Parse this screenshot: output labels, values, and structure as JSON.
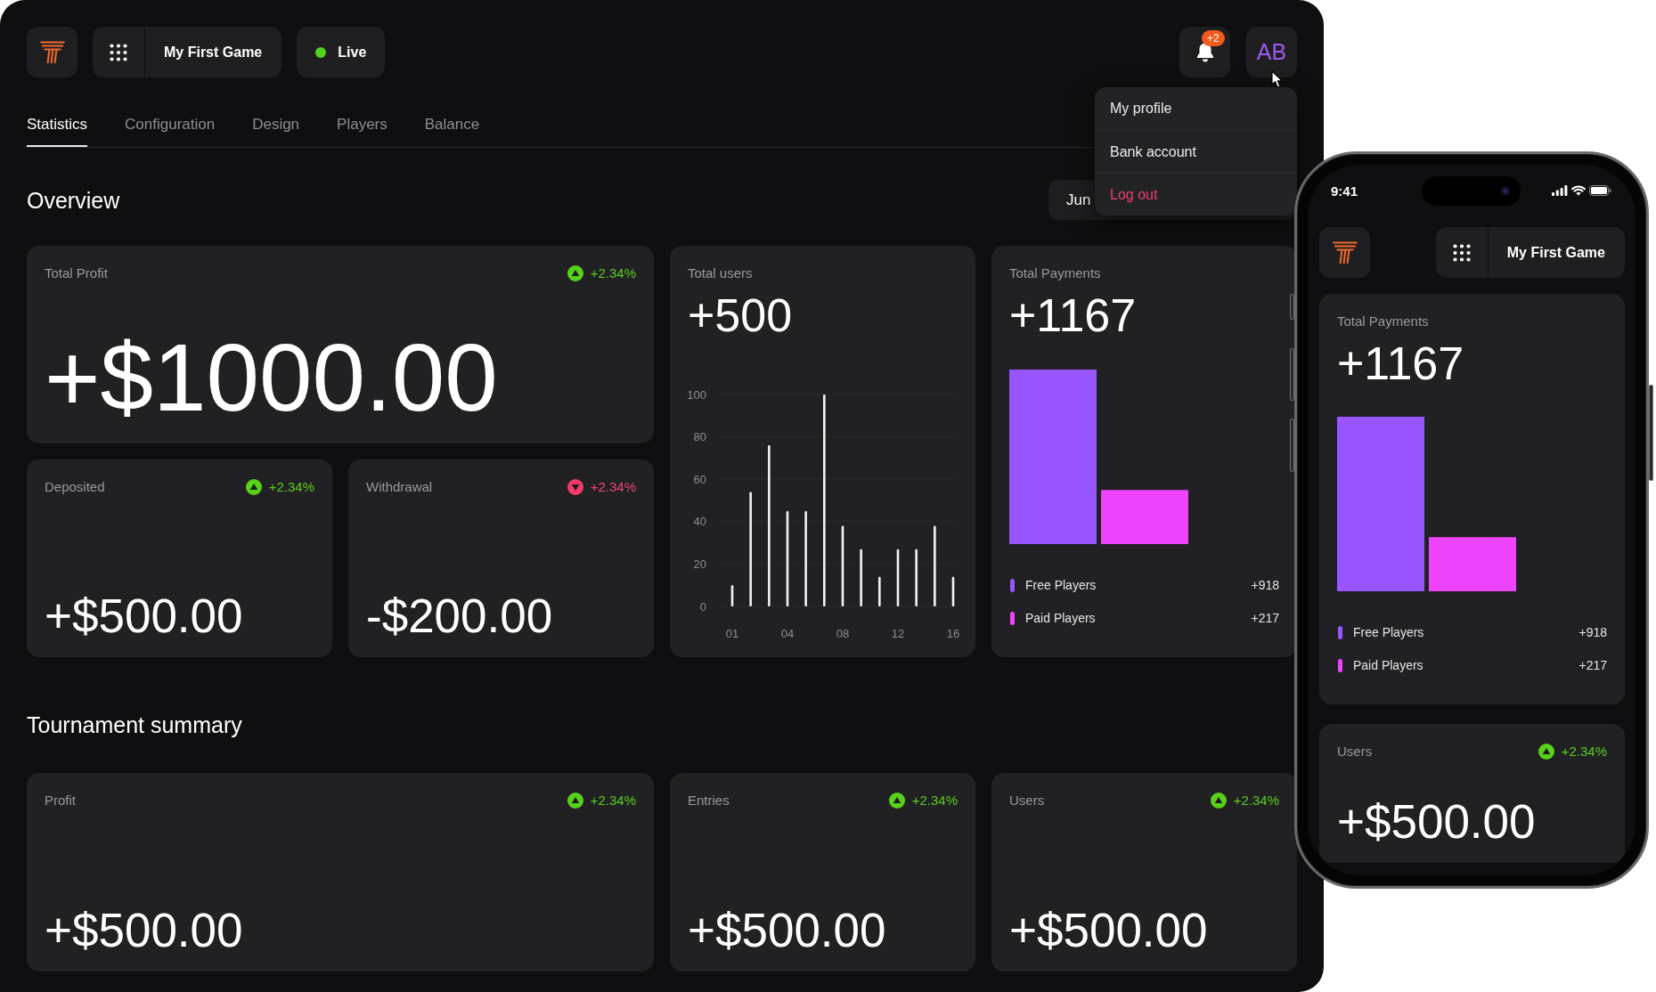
{
  "header": {
    "game_title": "My First Game",
    "status": {
      "label": "Live",
      "on": true
    },
    "notifications": {
      "badge": "+2"
    },
    "avatar": {
      "initials": "AB"
    }
  },
  "profile_menu": {
    "items": [
      {
        "label": "My profile",
        "kind": "link"
      },
      {
        "label": "Bank account",
        "kind": "link"
      },
      {
        "label": "Log out",
        "kind": "danger"
      }
    ]
  },
  "tabs": [
    {
      "label": "Statistics",
      "selected": true
    },
    {
      "label": "Configuration",
      "selected": false
    },
    {
      "label": "Design",
      "selected": false
    },
    {
      "label": "Players",
      "selected": false
    },
    {
      "label": "Balance",
      "selected": false
    }
  ],
  "overview": {
    "title": "Overview",
    "date_button": {
      "label": "Jun"
    },
    "profit_card": {
      "label": "Total Profit",
      "change": "+2.34%",
      "rising": true,
      "value": "+$1000.00"
    },
    "users_card": {
      "label": "Total users",
      "value": "+500",
      "chart_data": {
        "type": "bar",
        "categories": [
          "01",
          null,
          null,
          "04",
          null,
          null,
          "08",
          null,
          null,
          "12",
          null,
          null,
          "16"
        ],
        "values": [
          10,
          54,
          76,
          45,
          45,
          100,
          38,
          27,
          14,
          27,
          27,
          38,
          14
        ],
        "ylim": [
          0,
          100
        ],
        "yticks": [
          0,
          20,
          40,
          60,
          80,
          100
        ],
        "grid": true
      }
    },
    "payments_card": {
      "label": "Total Payments",
      "value": "+1167",
      "legend": [
        {
          "label": "Free Players",
          "value": "+918",
          "color": "#9955ff"
        },
        {
          "label": "Paid Players",
          "value": "+217",
          "color": "#ee44fc"
        }
      ]
    },
    "balance_cards": [
      {
        "label": "Deposited",
        "change": "+2.34%",
        "rising": true,
        "value": "+$500.00"
      },
      {
        "label": "Withdrawal",
        "change": "+2.34%",
        "rising": false,
        "value": "-$200.00"
      }
    ]
  },
  "tournament": {
    "title": "Tournament summary",
    "cards": [
      {
        "label": "Profit",
        "change": "+2.34%",
        "rising": true,
        "value": "+$500.00"
      },
      {
        "label": "Entries",
        "change": "+2.34%",
        "rising": true,
        "value": "+$500.00"
      },
      {
        "label": "Users",
        "change": "+2.34%",
        "rising": true,
        "value": "+$500.00"
      }
    ]
  },
  "phone": {
    "status_bar": {
      "time": "9:41"
    },
    "game_title": "My First Game",
    "payments_card": {
      "label": "Total Payments",
      "value": "+1167",
      "legend": [
        {
          "label": "Free Players",
          "value": "+918",
          "color": "#9955ff"
        },
        {
          "label": "Paid Players",
          "value": "+217",
          "color": "#ee44fc"
        }
      ]
    },
    "users_card": {
      "label": "Users",
      "change": "+2.34%",
      "rising": true,
      "value": "+$500.00"
    }
  }
}
